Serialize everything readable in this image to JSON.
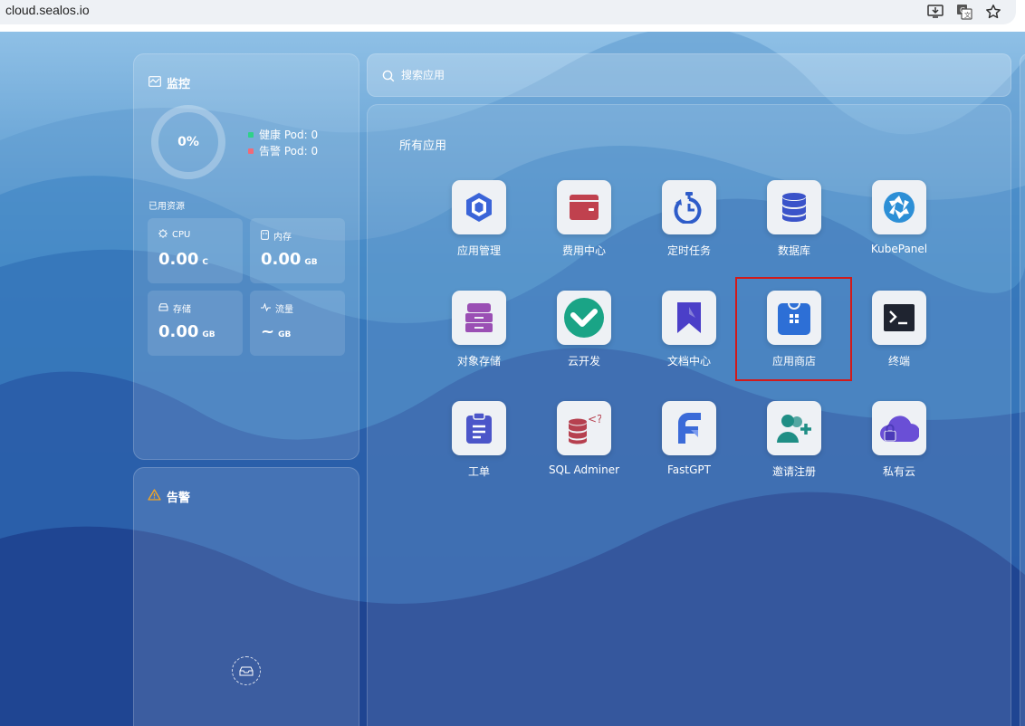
{
  "browser": {
    "url": "cloud.sealos.io"
  },
  "monitor": {
    "title": "监控",
    "usage_percent": "0%",
    "healthy_pod": "健康 Pod: 0",
    "alert_pod": "告警 Pod: 0",
    "used_resources_label": "已用资源",
    "stats": [
      {
        "name": "CPU",
        "value": "0.00",
        "unit": "C"
      },
      {
        "name": "内存",
        "value": "0.00",
        "unit": "GB"
      },
      {
        "name": "存储",
        "value": "0.00",
        "unit": "GB"
      },
      {
        "name": "流量",
        "value": "~",
        "unit": "GB"
      }
    ]
  },
  "alerts": {
    "title": "告警"
  },
  "search": {
    "placeholder": "搜索应用"
  },
  "apps": {
    "section_title": "所有应用",
    "items": [
      {
        "label": "应用管理",
        "icon": "app-launchpad-icon"
      },
      {
        "label": "费用中心",
        "icon": "wallet-icon"
      },
      {
        "label": "定时任务",
        "icon": "timer-icon"
      },
      {
        "label": "数据库",
        "icon": "database-icon"
      },
      {
        "label": "KubePanel",
        "icon": "kubepanel-aperture-icon"
      },
      {
        "label": "对象存储",
        "icon": "object-storage-icon"
      },
      {
        "label": "云开发",
        "icon": "cloud-dev-icon"
      },
      {
        "label": "文档中心",
        "icon": "bookmark-doc-icon"
      },
      {
        "label": "应用商店",
        "icon": "app-store-bag-icon"
      },
      {
        "label": "终端",
        "icon": "terminal-icon"
      },
      {
        "label": "工单",
        "icon": "clipboard-ticket-icon"
      },
      {
        "label": "SQL Adminer",
        "icon": "sql-database-icon"
      },
      {
        "label": "FastGPT",
        "icon": "fastgpt-icon"
      },
      {
        "label": "邀请注册",
        "icon": "invite-user-icon"
      },
      {
        "label": "私有云",
        "icon": "private-cloud-icon"
      }
    ]
  },
  "colors": {
    "healthy": "#2fd189",
    "alert": "#f06a78",
    "highlight": "#d11a1a"
  }
}
